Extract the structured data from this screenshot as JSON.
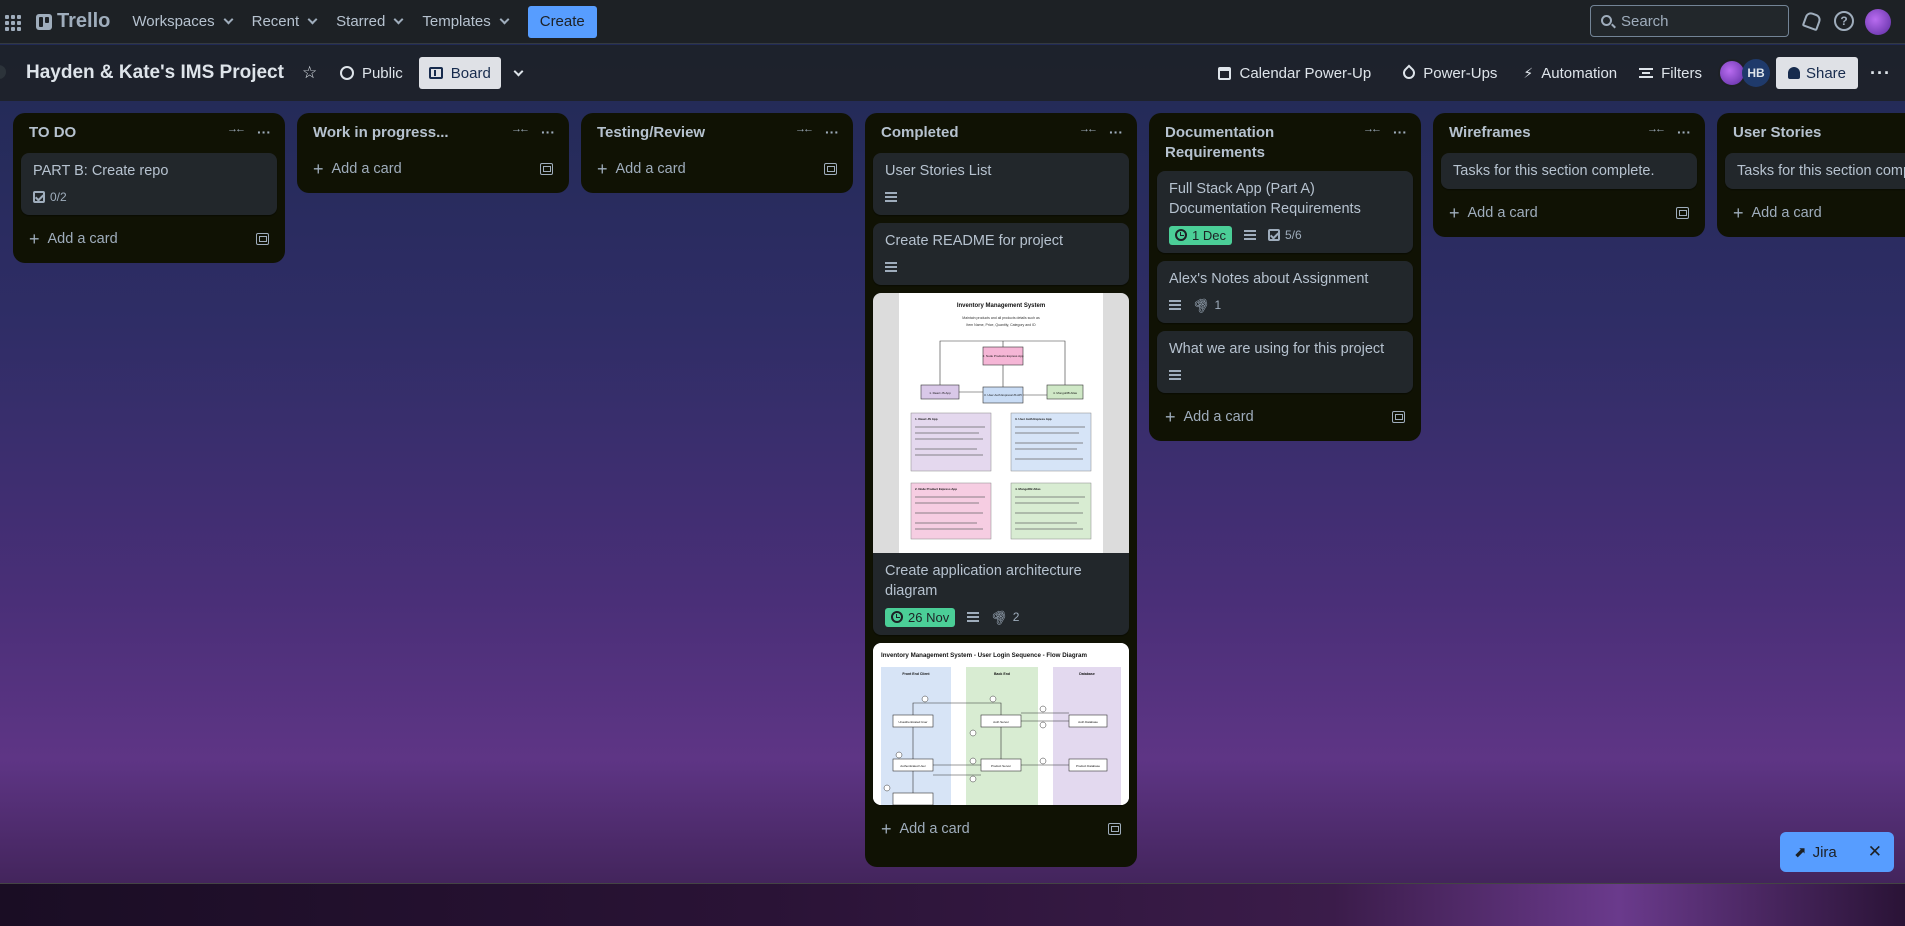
{
  "nav": {
    "workspaces": "Workspaces",
    "recent": "Recent",
    "starred": "Starred",
    "templates": "Templates",
    "create": "Create",
    "search_placeholder": "Search",
    "logo": "Trello",
    "help": "?"
  },
  "board": {
    "title": "Hayden & Kate's IMS Project",
    "visibility": "Public",
    "view": "Board",
    "calendar": "Calendar Power-Up",
    "powerups": "Power-Ups",
    "automation": "Automation",
    "filters": "Filters",
    "member_initials": "HB",
    "share": "Share"
  },
  "lists": [
    {
      "title": "TO DO",
      "cards": [
        {
          "title": "PART B: Create repo",
          "checklist": "0/2"
        }
      ],
      "add": "Add a card"
    },
    {
      "title": "Work in progress...",
      "add": "Add a card"
    },
    {
      "title": "Testing/Review",
      "add": "Add a card"
    },
    {
      "title": "Completed",
      "cards": [
        {
          "title": "User Stories List"
        },
        {
          "title": "Create README for project"
        },
        {
          "title": "Create application architecture diagram",
          "date": "26 Nov",
          "attachments": "2"
        },
        {
          "title": ""
        }
      ],
      "add": "Add a card"
    },
    {
      "title": "Documentation Requirements",
      "cards": [
        {
          "title": "Full Stack App (Part A) Documentation Requirements",
          "date": "1 Dec",
          "checklist": "5/6"
        },
        {
          "title": "Alex's Notes about Assignment",
          "attachments": "1"
        },
        {
          "title": "What we are using for this project"
        }
      ],
      "add": "Add a card"
    },
    {
      "title": "Wireframes",
      "cards": [
        {
          "title": "Tasks for this section complete."
        }
      ],
      "add": "Add a card"
    },
    {
      "title": "User Stories",
      "cards": [
        {
          "title": "Tasks for this section complete."
        }
      ],
      "add": "Add a card"
    }
  ],
  "covers": {
    "architecture": {
      "title": "Inventory Management System",
      "subtitle_1": "Maintain products and all products details such as",
      "subtitle_2": "Item Name, Price, Quantity, Category and ID",
      "box_a": "2. Node Products Express App",
      "box_b": "1. React JS App",
      "box_c": "3. User Auth Express/JS API",
      "box_d": "4. MongoDB Atlas",
      "panel_1": "1. React JS App",
      "panel_2": "3. User Auth Express App",
      "panel_3": "2. Node Product Express App",
      "panel_4": "4. MongoDB Atlas"
    },
    "login_flow": {
      "title": "Inventory Management System - User Login Sequence - Flow Diagram",
      "col_1": "Front End Client",
      "col_2": "Back End",
      "col_3": "Database",
      "box_1": "Unauthenticated User",
      "box_2": "Auth Server",
      "box_3": "Auth Database",
      "box_4": "Authenticated User",
      "box_5": "Product Server",
      "box_6": "Product Database"
    }
  },
  "jira": {
    "label": "Jira",
    "close": "✕"
  }
}
